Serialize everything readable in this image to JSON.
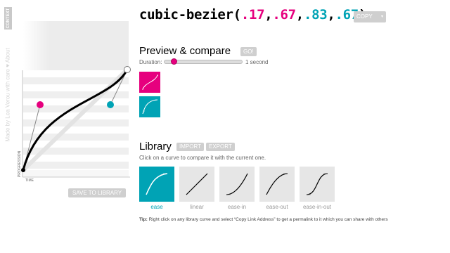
{
  "side_tab": {
    "label": "CONTEXT"
  },
  "credit": {
    "text": "Made by Lea Verou with care ♥ About"
  },
  "title": {
    "prefix": "cubic-bezier(",
    "p1": ".17",
    "p2": ".67",
    "p3": ".83",
    "p4": ".67",
    "sep": ",",
    "suffix": ")"
  },
  "copy_button": {
    "label": "COPY",
    "arrow": "▾"
  },
  "preview": {
    "heading": "Preview & compare",
    "go_label": "GO!",
    "duration_label": "Duration:",
    "duration_value": "1 second",
    "duration_fraction": 0.1
  },
  "library": {
    "heading": "Library",
    "import_label": "IMPORT",
    "export_label": "EXPORT",
    "hint": "Click on a curve to compare it with the current one.",
    "items": [
      {
        "label": "ease",
        "selected": true
      },
      {
        "label": "linear",
        "selected": false
      },
      {
        "label": "ease-in",
        "selected": false
      },
      {
        "label": "ease-out",
        "selected": false
      },
      {
        "label": "ease-in-out",
        "selected": false
      }
    ],
    "tip_bold": "Tip:",
    "tip_text": "Right click on any library curve and select “Copy Link Address” to get a permalink to it which you can share with others"
  },
  "graph": {
    "progression_label": "PROGRESSION",
    "time_label": "TIME",
    "save_label": "SAVE TO LIBRARY",
    "p1": [
      0.17,
      0.67
    ],
    "p2": [
      0.83,
      0.67
    ]
  },
  "colors": {
    "pink": "#e6007e",
    "teal": "#00a3b5",
    "button_gray": "#cfcfcf"
  }
}
